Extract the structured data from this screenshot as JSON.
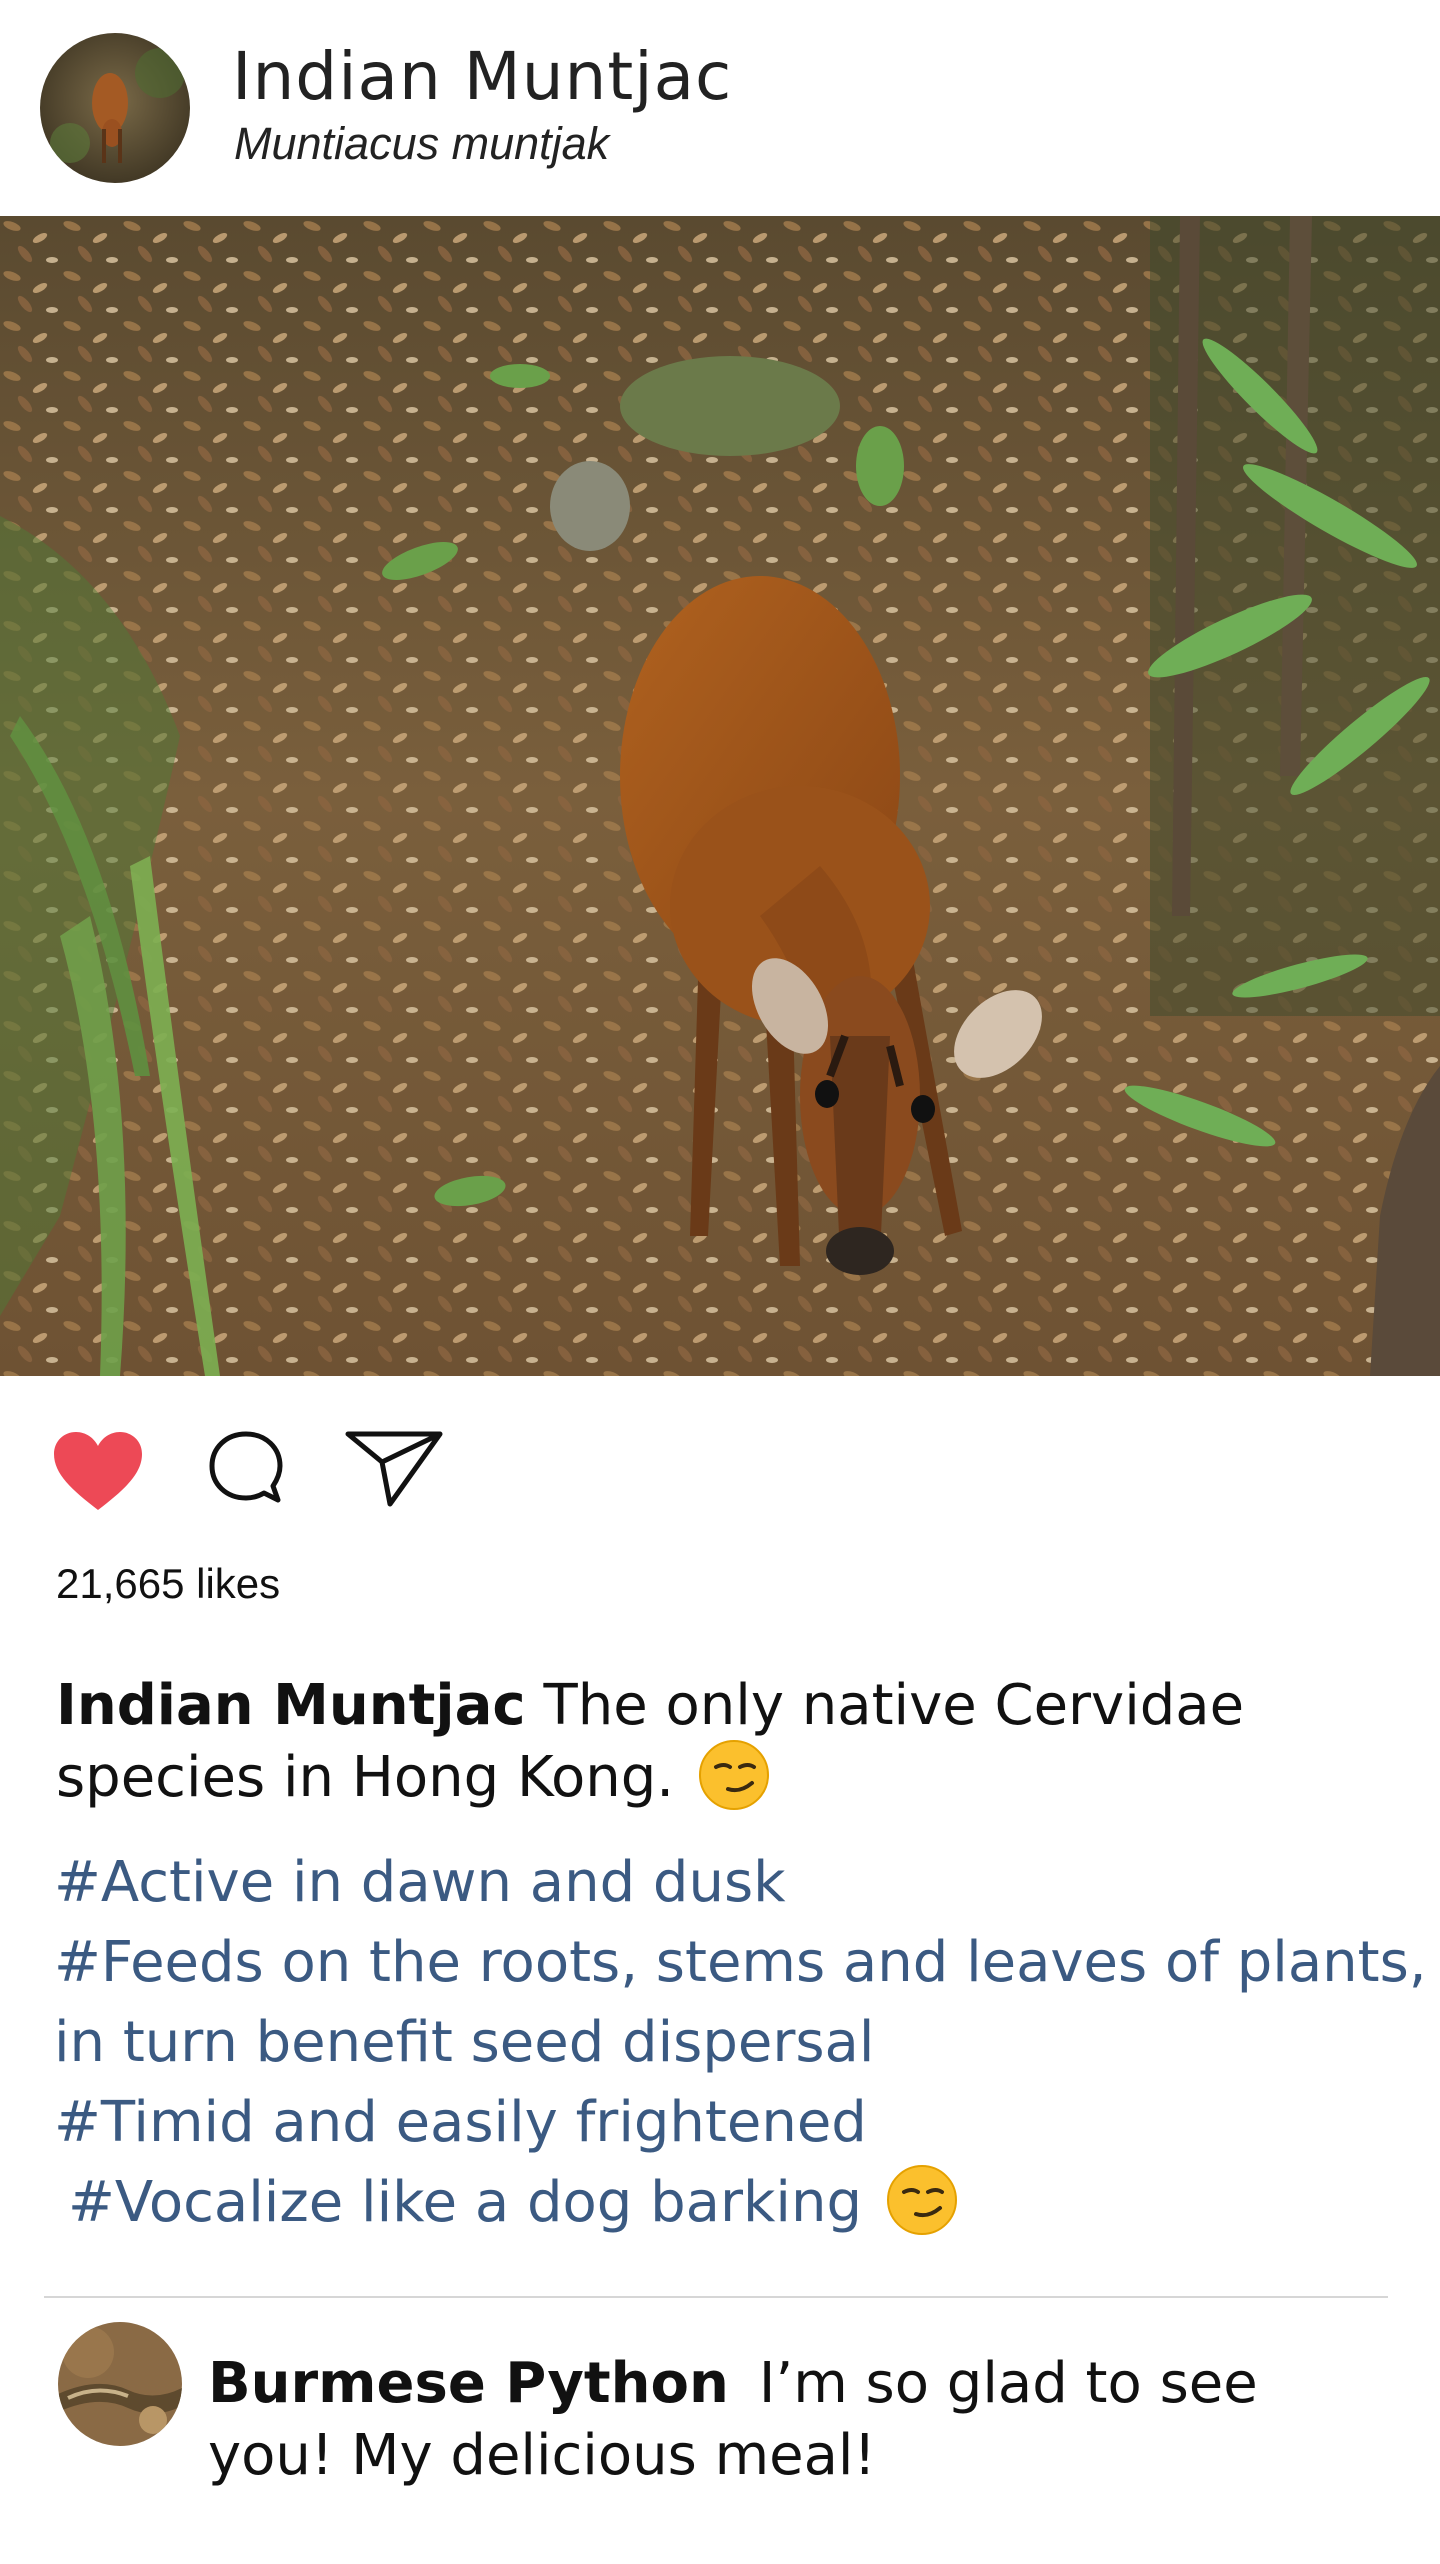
{
  "post": {
    "title": "Indian Muntjac",
    "subtitle": "Muntiacus muntjak",
    "avatar_icon": "muntjac-avatar",
    "photo_description": "deer-standing-on-forest-floor"
  },
  "actions": {
    "like_icon": "heart-icon",
    "comment_icon": "comment-bubble-icon",
    "share_icon": "paper-plane-icon",
    "liked": true,
    "like_color": "#ed4956"
  },
  "likes": "21,665 likes",
  "caption": {
    "username": "Indian Muntjac",
    "text": "The only native Cervidae species in Hong Kong."
  },
  "hashtags": [
    "#Active in dawn and dusk",
    "#Feeds on the roots, stems and leaves of plants,",
    "in turn benefit seed dispersal",
    "#Timid and easily frightened",
    "#Vocalize like a dog barking"
  ],
  "hashtag_color": "#3b5a82",
  "comment": {
    "username": "Burmese Python",
    "text": "I’m so glad to see you! My delicious meal!",
    "avatar_icon": "python-avatar"
  }
}
